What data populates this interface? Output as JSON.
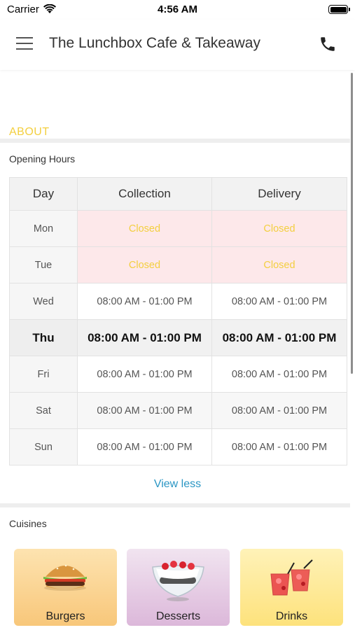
{
  "status_bar": {
    "carrier": "Carrier",
    "time": "4:56 AM"
  },
  "header": {
    "title": "The Lunchbox Cafe & Takeaway",
    "menu_icon": "hamburger-menu-icon",
    "phone_icon": "phone-icon"
  },
  "about": {
    "label": "ABOUT"
  },
  "opening_hours": {
    "title": "Opening Hours",
    "columns": [
      "Day",
      "Collection",
      "Delivery"
    ],
    "rows": [
      {
        "day": "Mon",
        "collection": "Closed",
        "delivery": "Closed"
      },
      {
        "day": "Tue",
        "collection": "Closed",
        "delivery": "Closed"
      },
      {
        "day": "Wed",
        "collection": "08:00 AM - 01:00 PM",
        "delivery": "08:00 AM - 01:00 PM"
      },
      {
        "day": "Thu",
        "collection": "08:00 AM - 01:00 PM",
        "delivery": "08:00 AM - 01:00 PM"
      },
      {
        "day": "Fri",
        "collection": "08:00 AM - 01:00 PM",
        "delivery": "08:00 AM - 01:00 PM"
      },
      {
        "day": "Sat",
        "collection": "08:00 AM - 01:00 PM",
        "delivery": "08:00 AM - 01:00 PM"
      },
      {
        "day": "Sun",
        "collection": "08:00 AM - 01:00 PM",
        "delivery": "08:00 AM - 01:00 PM"
      }
    ],
    "view_less": "View less"
  },
  "cuisines": {
    "title": "Cuisines",
    "items": [
      {
        "label": "Burgers",
        "icon": "burger-icon"
      },
      {
        "label": "Desserts",
        "icon": "dessert-bowl-icon"
      },
      {
        "label": "Drinks",
        "icon": "cocktail-drinks-icon"
      }
    ]
  },
  "colors": {
    "accent_yellow": "#f3cf3f",
    "link_blue": "#2a96c4",
    "closed_bg": "#fde8ea"
  }
}
